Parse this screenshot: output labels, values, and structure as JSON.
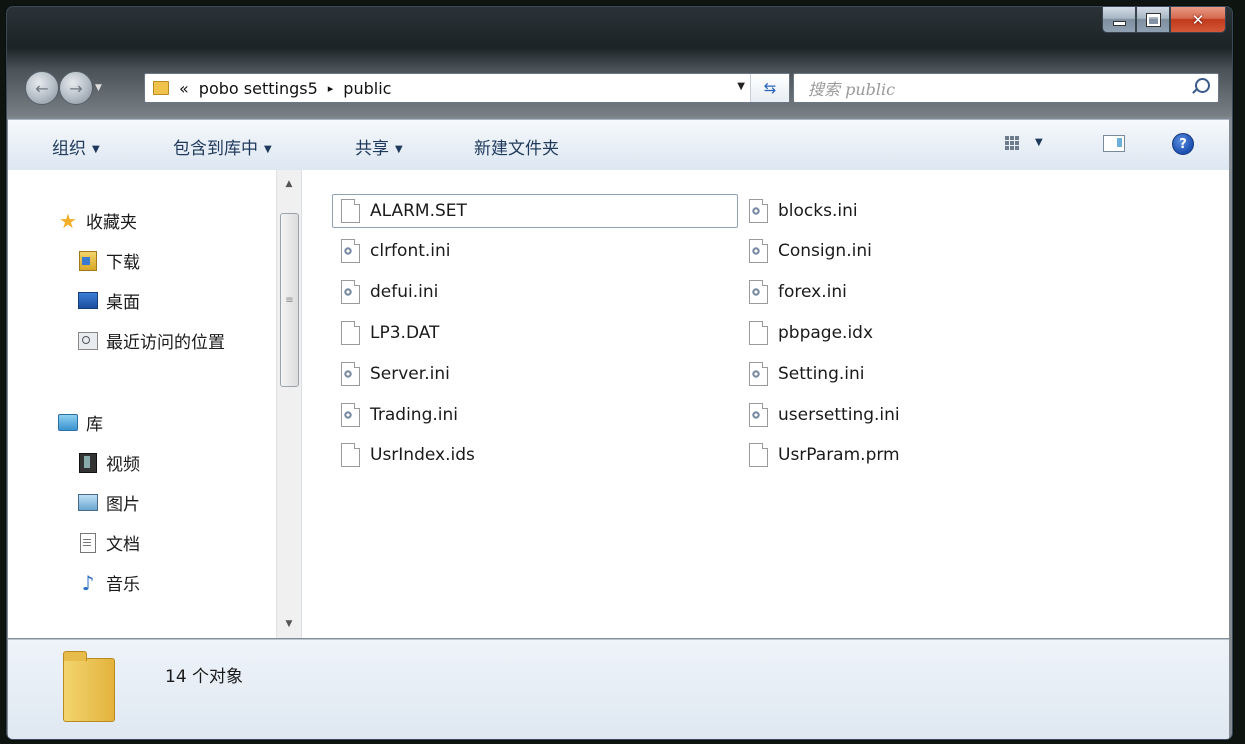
{
  "window": {
    "caption_buttons": {
      "minimize": "minimize-icon",
      "maximize": "maximize-icon",
      "close": "✕"
    }
  },
  "nav": {
    "back_icon": "←",
    "forward_icon": "→",
    "breadcrumb": {
      "overflow": "«",
      "parent": "pobo settings5",
      "separator": "▸",
      "current": "public"
    },
    "search_placeholder": "搜索 public"
  },
  "toolbar": {
    "organize": "组织",
    "include_in_library": "包含到库中",
    "share": "共享",
    "new_folder": "新建文件夹",
    "dropdown_arrow": "▼",
    "help": "?"
  },
  "sidebar": {
    "favorites": {
      "header": "收藏夹",
      "items": [
        {
          "label": "下载",
          "icon": "downloads-folder-icon"
        },
        {
          "label": "桌面",
          "icon": "desktop-icon"
        },
        {
          "label": "最近访问的位置",
          "icon": "recent-places-icon"
        }
      ]
    },
    "libraries": {
      "header": "库",
      "items": [
        {
          "label": "视频",
          "icon": "video-library-icon"
        },
        {
          "label": "图片",
          "icon": "pictures-library-icon"
        },
        {
          "label": "文档",
          "icon": "documents-library-icon"
        },
        {
          "label": "音乐",
          "icon": "music-library-icon"
        }
      ]
    }
  },
  "files": {
    "left": [
      {
        "name": "ALARM.SET",
        "icon": "file-icon",
        "selected": true
      },
      {
        "name": "clrfont.ini",
        "icon": "settings-file-icon"
      },
      {
        "name": "defui.ini",
        "icon": "settings-file-icon"
      },
      {
        "name": "LP3.DAT",
        "icon": "file-icon"
      },
      {
        "name": "Server.ini",
        "icon": "settings-file-icon"
      },
      {
        "name": "Trading.ini",
        "icon": "settings-file-icon"
      },
      {
        "name": "UsrIndex.ids",
        "icon": "file-icon"
      }
    ],
    "right": [
      {
        "name": "blocks.ini",
        "icon": "settings-file-icon"
      },
      {
        "name": "Consign.ini",
        "icon": "settings-file-icon"
      },
      {
        "name": "forex.ini",
        "icon": "settings-file-icon"
      },
      {
        "name": "pbpage.idx",
        "icon": "file-icon"
      },
      {
        "name": "Setting.ini",
        "icon": "settings-file-icon"
      },
      {
        "name": "usersetting.ini",
        "icon": "settings-file-icon"
      },
      {
        "name": "UsrParam.prm",
        "icon": "file-icon"
      }
    ]
  },
  "details": {
    "item_count": "14 个对象"
  }
}
